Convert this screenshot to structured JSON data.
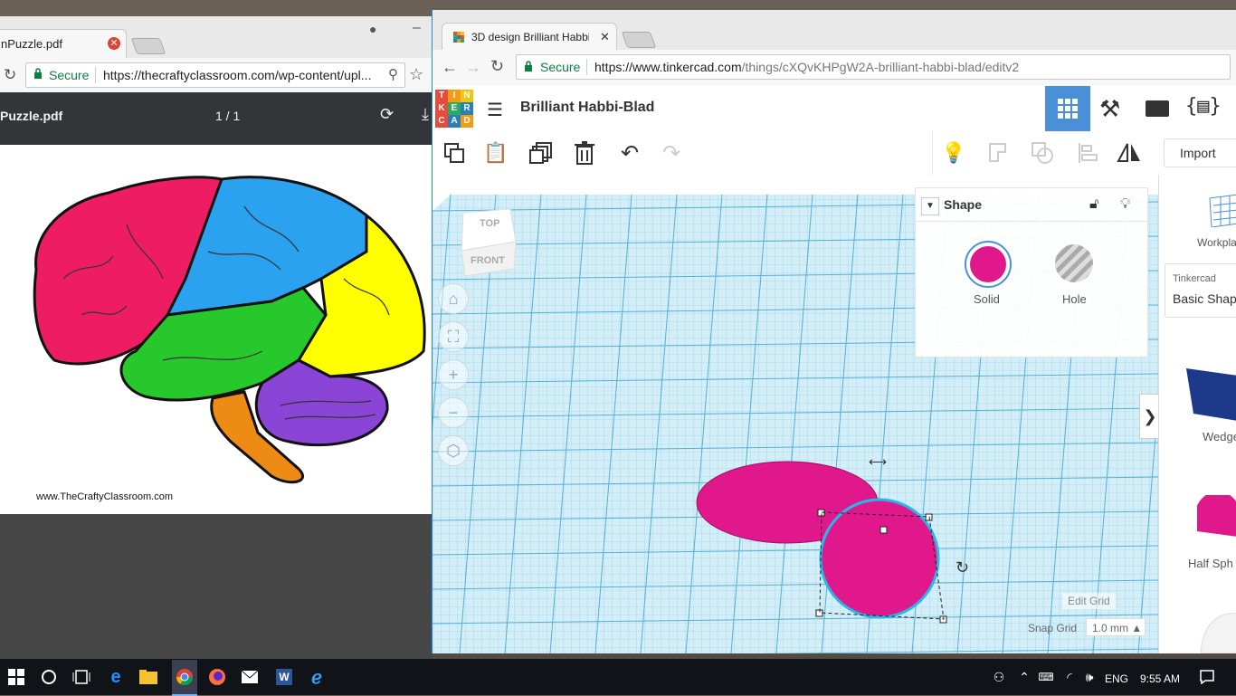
{
  "left_window": {
    "tab_title": "nPuzzle.pdf",
    "secure_label": "Secure",
    "url": "https://thecraftyclassroom.com/wp-content/upl...",
    "pdf_title": "Puzzle.pdf",
    "page_counter": "1 / 1",
    "watermark": "www.TheCraftyClassroom.com",
    "brain_colors": {
      "frontal": "#ee1d63",
      "parietal": "#2aa2ef",
      "occipital": "#ffff00",
      "temporal": "#27c82b",
      "cerebellum": "#8a44d6",
      "stem": "#ee8b14"
    }
  },
  "right_window": {
    "tab_title": "3D design Brilliant Habbi",
    "secure_label": "Secure",
    "url_host": "https://www.tinkercad.com",
    "url_path": "/things/cXQvKHPgW2A-brilliant-habbi-blad/editv2",
    "logo_letters": [
      "T",
      "I",
      "N",
      "K",
      "E",
      "R",
      "C",
      "A",
      "D"
    ],
    "logo_colors": [
      "#e64b3c",
      "#f39c12",
      "#f1c40f",
      "#e64b3c",
      "#27ae60",
      "#2980b9",
      "#e64b3c",
      "#2980b9",
      "#f39c12"
    ],
    "design_name": "Brilliant Habbi-Blad",
    "import_label": "Import",
    "view_cube": {
      "top": "TOP",
      "front": "FRONT"
    },
    "shape_panel": {
      "title": "Shape",
      "solid_label": "Solid",
      "hole_label": "Hole",
      "solid_color": "#e0188c"
    },
    "sidebar": {
      "workplane_label": "Workpla",
      "library_caption": "Tinkercad",
      "library_value": "Basic Shap",
      "shape1": "Wedge",
      "shape2": "Half Sph"
    },
    "edit_grid_label": "Edit Grid",
    "snap_grid_label": "Snap Grid",
    "snap_grid_value": "1.0 mm ▲"
  },
  "taskbar": {
    "language": "ENG",
    "time": "9:55 AM"
  }
}
